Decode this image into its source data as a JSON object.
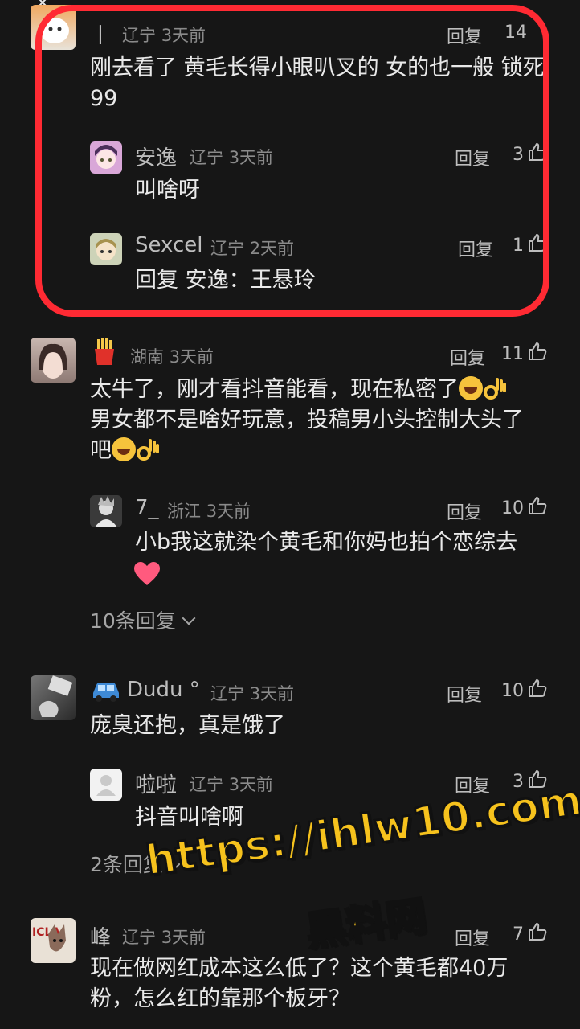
{
  "comments": [
    {
      "name": "丨",
      "region": "辽宁",
      "time": "3天前",
      "reply_label": "回复",
      "likes": "14",
      "text": "刚去看了 黄毛长得小眼叭叉的 女的也一般 锁死 99",
      "replies": [
        {
          "name": "安逸",
          "region": "辽宁",
          "time": "3天前",
          "reply_label": "回复",
          "likes": "3",
          "text": "叫啥呀"
        },
        {
          "name": "Sexcel",
          "region": "辽宁",
          "time": "2天前",
          "reply_label": "回复",
          "likes": "1",
          "text": "回复 安逸：王悬玲"
        }
      ]
    },
    {
      "name": "湖南",
      "time": "3天前",
      "reply_label": "回复",
      "likes": "11",
      "text_line1": "太牛了，刚才看抖音能看，现在私密了",
      "text_line2": "男女都不是啥好玩意，投稿男小头控制大头了",
      "text_line3": "吧",
      "replies": [
        {
          "name": "7_",
          "region": "浙江",
          "time": "3天前",
          "reply_label": "回复",
          "likes": "10",
          "text": "小b我这就染个黄毛和你妈也拍个恋综去"
        }
      ],
      "expand_label": "10条回复"
    },
    {
      "name": "Dudu °",
      "region": "辽宁",
      "time": "3天前",
      "reply_label": "回复",
      "likes": "10",
      "text": "庞臭还抱，真是饿了",
      "replies": [
        {
          "name": "啦啦",
          "region": "辽宁",
          "time": "3天前",
          "reply_label": "回复",
          "likes": "3",
          "text": "抖音叫啥啊"
        }
      ],
      "expand_label": "2条回复"
    },
    {
      "name": "峰",
      "region": "辽宁",
      "time": "3天前",
      "reply_label": "回复",
      "likes": "7",
      "text_line1": "现在做网红成本这么低了？这个黄毛都40万",
      "text_line2": "粉，怎么红的靠那个板牙？"
    }
  ],
  "watermark": {
    "line1": "https://ihlw10.com",
    "line2": "黑料网"
  },
  "colors": {
    "highlight": "#ff2a33",
    "watermark": "#f6c21d",
    "background": "#161616"
  }
}
